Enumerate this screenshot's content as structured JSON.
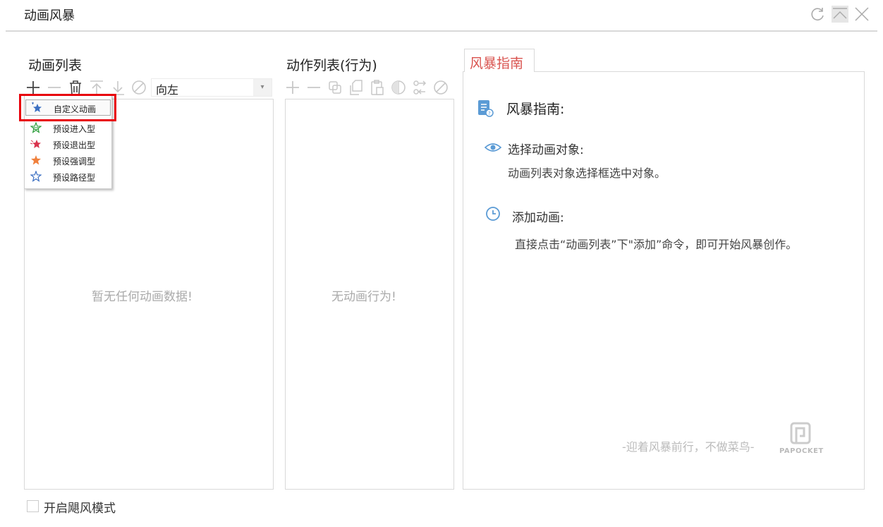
{
  "window": {
    "title": "动画风暴",
    "controls": [
      "refresh-icon",
      "minimize-icon",
      "close-icon"
    ]
  },
  "animation_list": {
    "heading": "动画列表",
    "toolbar_icons": [
      "add-icon",
      "remove-icon",
      "delete-icon",
      "move-up-icon",
      "move-down-icon",
      "disable-icon"
    ],
    "direction_select": {
      "value": "向左"
    },
    "empty_text": "暂无任何动画数据!"
  },
  "add_menu": {
    "items": [
      {
        "label": "自定义动画",
        "icon": "custom-star-icon",
        "color": "#3b6fc2"
      },
      {
        "label": "预设进入型",
        "icon": "entrance-star-icon",
        "color": "#2e9e3c"
      },
      {
        "label": "预设退出型",
        "icon": "exit-star-icon",
        "color": "#d9334d"
      },
      {
        "label": "预设强调型",
        "icon": "emphasis-star-icon",
        "color": "#f0803c"
      },
      {
        "label": "预设路径型",
        "icon": "path-star-icon",
        "color": "#3b6fc2"
      }
    ]
  },
  "action_list": {
    "heading": "动作列表(行为)",
    "toolbar_icons": [
      "add-icon",
      "remove-icon",
      "copy-icon",
      "duplicate-icon",
      "paste-icon",
      "mirror-icon",
      "connect-icon",
      "disable-icon"
    ],
    "empty_text": "无动画行为!"
  },
  "guide": {
    "tab_label": "风暴指南",
    "title": "风暴指南:",
    "step1_title": "选择动画对象:",
    "step1_desc": "动画列表对象选择框选中对象。",
    "step2_title": "添加动画:",
    "step2_desc": "直接点击“动画列表”下\"添加”命令，即可开始风暴创作。",
    "footer": "-迎着风暴前行，不做菜鸟-",
    "logo_text": "PAPOCKET"
  },
  "footer_option": {
    "label": "开启飓风模式",
    "checked": false
  },
  "colors": {
    "accent_red": "#e8000b",
    "tab_text": "#d9534f",
    "icon_blue": "#5b9bd5",
    "disabled_grey": "#c8c8c8"
  }
}
